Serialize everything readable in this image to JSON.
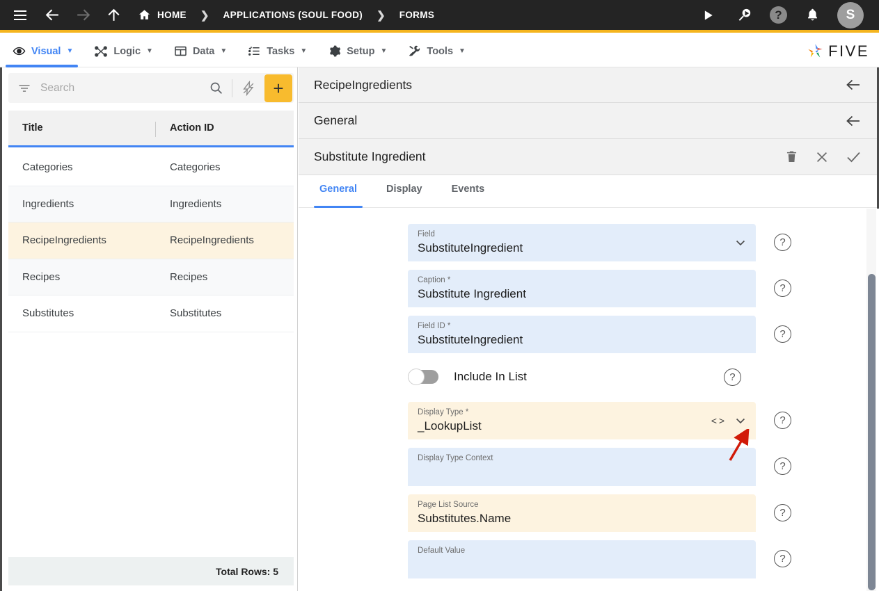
{
  "topbar": {
    "icons": [
      "hamburger-icon",
      "back-arrow-icon",
      "forward-arrow-icon",
      "up-arrow-icon"
    ],
    "breadcrumb": [
      {
        "label": "HOME",
        "icon": "home-icon"
      },
      {
        "label": "APPLICATIONS (SOUL FOOD)",
        "icon": ""
      },
      {
        "label": "FORMS",
        "icon": ""
      }
    ],
    "separator": "❯",
    "right_icons": [
      "run-play-icon",
      "search-debug-icon",
      "help-icon",
      "notification-bell-icon"
    ],
    "help_glyph": "?",
    "avatar_initial": "S"
  },
  "menubar": {
    "items": [
      {
        "label": "Visual",
        "icon": "eye-icon",
        "active": true
      },
      {
        "label": "Logic",
        "icon": "logic-nodes-icon",
        "active": false
      },
      {
        "label": "Data",
        "icon": "table-grid-icon",
        "active": false
      },
      {
        "label": "Tasks",
        "icon": "checklist-icon",
        "active": false
      },
      {
        "label": "Setup",
        "icon": "gear-icon",
        "active": false
      },
      {
        "label": "Tools",
        "icon": "tools-wrench-icon",
        "active": false
      }
    ],
    "caret": "▼",
    "brand": "FIVE",
    "accent_blue": "#4285f4",
    "accent_yellow": "#f5b51f"
  },
  "sidebar": {
    "search": {
      "placeholder": "Search",
      "value": ""
    },
    "icons": {
      "filter": "filter-icon",
      "search": "search-icon",
      "lightning": "lightning-slash-icon",
      "add": "plus-icon"
    },
    "add_label": "+",
    "columns": [
      "Title",
      "Action ID"
    ],
    "rows": [
      {
        "title": "Categories",
        "action_id": "Categories",
        "selected": false
      },
      {
        "title": "Ingredients",
        "action_id": "Ingredients",
        "selected": false
      },
      {
        "title": "RecipeIngredients",
        "action_id": "RecipeIngredients",
        "selected": true
      },
      {
        "title": "Recipes",
        "action_id": "Recipes",
        "selected": false
      },
      {
        "title": "Substitutes",
        "action_id": "Substitutes",
        "selected": false
      }
    ],
    "total_rows": "Total Rows: 5",
    "selected_row_color": "#fdf3e0"
  },
  "detail": {
    "breadcrumb_rows": [
      {
        "title": "RecipeIngredients",
        "back_icon": "back-arrow-icon"
      },
      {
        "title": "General",
        "back_icon": "back-arrow-icon"
      }
    ],
    "record_title": "Substitute Ingredient",
    "record_actions": [
      "delete-trash-icon",
      "close-x-icon",
      "confirm-check-icon"
    ],
    "tabs": [
      {
        "label": "General",
        "active": true
      },
      {
        "label": "Display",
        "active": false
      },
      {
        "label": "Events",
        "active": false
      }
    ],
    "help_glyph": "?",
    "fields": [
      {
        "label": "Field",
        "value": "SubstituteIngredient",
        "style": "blue",
        "dropdown": true,
        "code": false
      },
      {
        "label": "Caption *",
        "value": "Substitute Ingredient",
        "style": "blue",
        "dropdown": false,
        "code": false
      },
      {
        "label": "Field ID *",
        "value": "SubstituteIngredient",
        "style": "blue",
        "dropdown": false,
        "code": false
      },
      {
        "label": "Display Type *",
        "value": "_LookupList",
        "style": "tan",
        "dropdown": true,
        "code": true
      },
      {
        "label": "Display Type Context",
        "value": "",
        "style": "blue",
        "dropdown": false,
        "code": false
      },
      {
        "label": "Page List Source",
        "value": "Substitutes.Name",
        "style": "tan",
        "dropdown": false,
        "code": false
      },
      {
        "label": "Default Value",
        "value": "",
        "style": "blue",
        "dropdown": false,
        "code": false
      }
    ],
    "toggle": {
      "label": "Include In List",
      "on": false
    },
    "annotation": {
      "type": "red-arrow",
      "color": "#d11a08",
      "points_to": "display-type-dropdown-chevron"
    }
  }
}
